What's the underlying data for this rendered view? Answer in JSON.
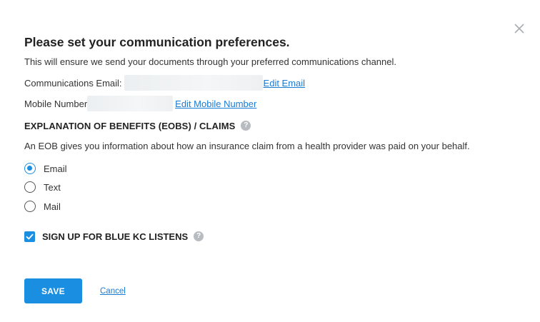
{
  "dialog": {
    "title": "Please set your communication preferences.",
    "subtitle": "This will ensure we send your documents through your preferred communications channel.",
    "close_icon": "close-icon"
  },
  "email_row": {
    "label": "Communications Email:",
    "edit_link": "Edit Email"
  },
  "mobile_row": {
    "label": "Mobile Number",
    "edit_link": "Edit Mobile Number"
  },
  "eob_section": {
    "heading": "EXPLANATION OF BENEFITS (EOBS) / CLAIMS",
    "help_icon": "help-icon",
    "description": "An EOB gives you information about how an insurance claim from a health provider was paid on your behalf.",
    "options": [
      {
        "label": "Email",
        "selected": true
      },
      {
        "label": "Text",
        "selected": false
      },
      {
        "label": "Mail",
        "selected": false
      }
    ]
  },
  "listens": {
    "label": "SIGN UP FOR BLUE KC LISTENS",
    "checked": true,
    "help_icon": "help-icon"
  },
  "actions": {
    "save_label": "SAVE",
    "cancel_label": "Cancel"
  },
  "colors": {
    "accent": "#1a8ee0",
    "link": "#1a7bd3",
    "help_icon_bg": "#b8bcc0"
  }
}
